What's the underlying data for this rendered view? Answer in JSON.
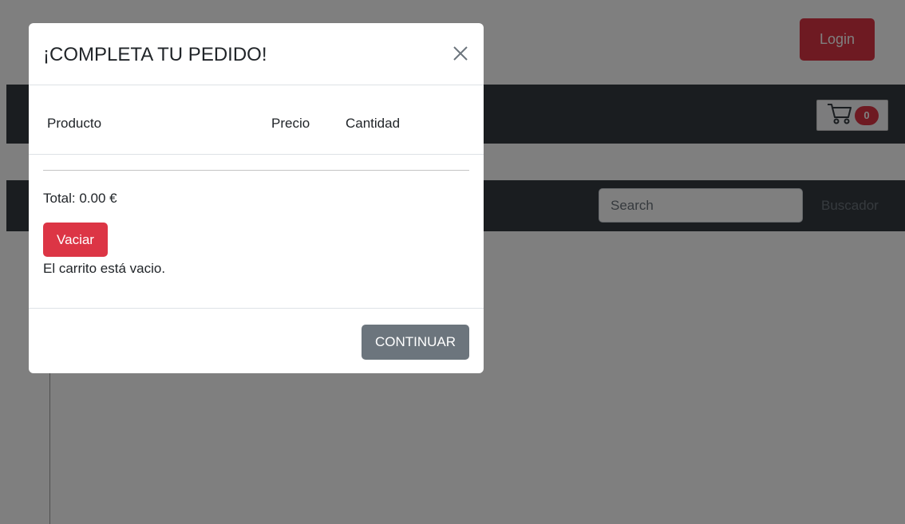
{
  "header": {
    "login_label": "Login",
    "cart_count": "0"
  },
  "search": {
    "placeholder": "Search",
    "button_label": "Buscador"
  },
  "modal": {
    "title": "¡COMPLETA TU PEDIDO!",
    "table": {
      "columns": [
        "Producto",
        "Precio",
        "Cantidad"
      ]
    },
    "total": "Total: 0.00 €",
    "empty_button_label": "Vaciar",
    "empty_message": "El carrito está vacio.",
    "continue_label": "CONTINUAR"
  },
  "colors": {
    "danger": "#dc3545",
    "secondary": "#6c757d",
    "navbar_dark": "#343a40"
  }
}
